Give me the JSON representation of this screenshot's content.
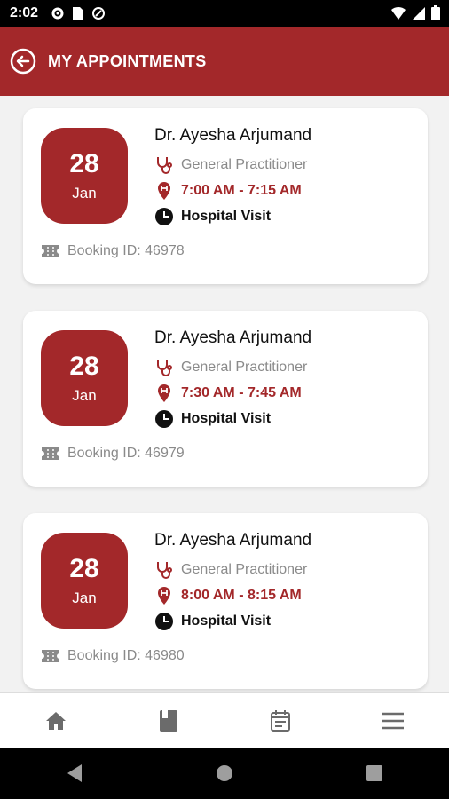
{
  "status": {
    "time": "2:02"
  },
  "header": {
    "title": "MY APPOINTMENTS"
  },
  "appointments": [
    {
      "day": "28",
      "month": "Jan",
      "doctor": "Dr. Ayesha Arjumand",
      "specialty": "General Practitioner",
      "time": "7:00 AM - 7:15 AM",
      "visit": "Hospital Visit",
      "booking": "Booking ID: 46978"
    },
    {
      "day": "28",
      "month": "Jan",
      "doctor": "Dr. Ayesha Arjumand",
      "specialty": "General Practitioner",
      "time": "7:30 AM - 7:45 AM",
      "visit": "Hospital Visit",
      "booking": "Booking ID: 46979"
    },
    {
      "day": "28",
      "month": "Jan",
      "doctor": "Dr. Ayesha Arjumand",
      "specialty": "General Practitioner",
      "time": "8:00 AM - 8:15 AM",
      "visit": "Hospital Visit",
      "booking": "Booking ID: 46980"
    }
  ],
  "nav": {
    "items": [
      "home-icon",
      "book-icon",
      "calendar-icon",
      "menu-icon"
    ]
  },
  "colors": {
    "brand": "#a3282a",
    "muted": "#8a8a8a"
  }
}
